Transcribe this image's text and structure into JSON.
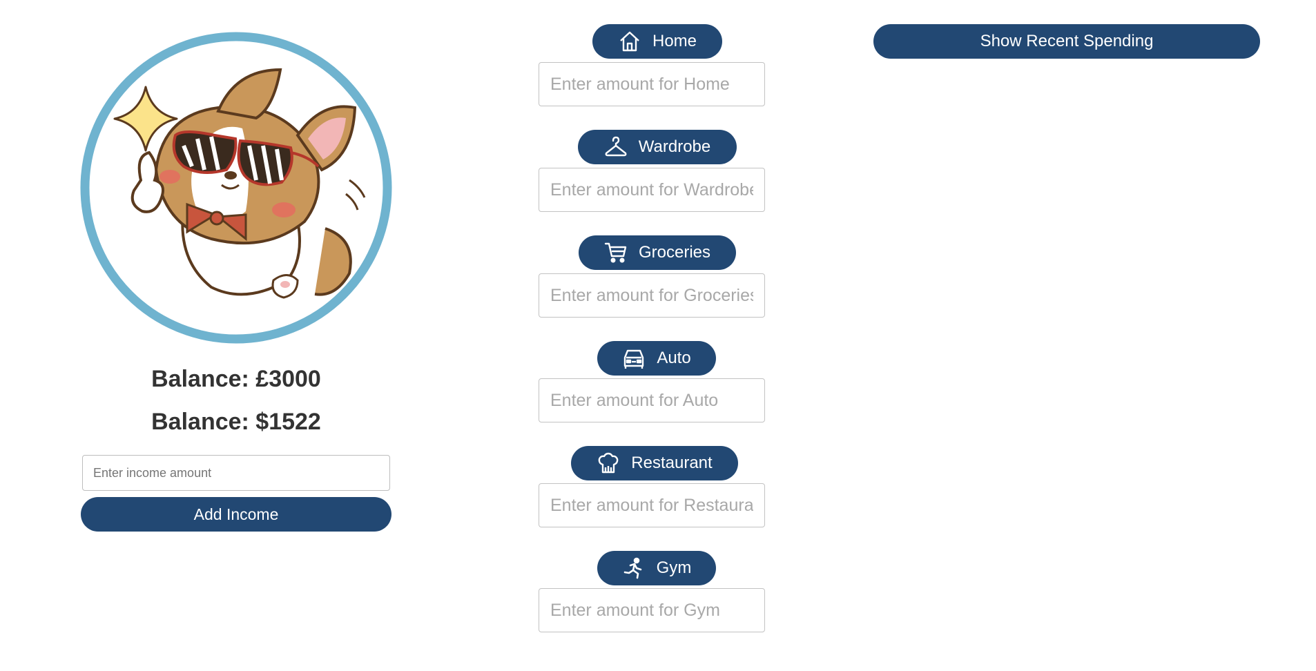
{
  "profile": {
    "avatar_icon": "corgi-with-sunglasses-avatar",
    "ring_color": "#6fb3cf"
  },
  "balances": {
    "gbp": "Balance: £3000",
    "usd": "Balance: $1522"
  },
  "income": {
    "placeholder": "Enter income amount",
    "value": "",
    "button_label": "Add Income"
  },
  "categories": [
    {
      "label": "Home",
      "icon": "home-icon",
      "placeholder": "Enter amount for Home",
      "value": ""
    },
    {
      "label": "Wardrobe",
      "icon": "hanger-icon",
      "placeholder": "Enter amount for Wardrobe",
      "value": ""
    },
    {
      "label": "Groceries",
      "icon": "cart-icon",
      "placeholder": "Enter amount for Groceries",
      "value": ""
    },
    {
      "label": "Auto",
      "icon": "car-icon",
      "placeholder": "Enter amount for Auto",
      "value": ""
    },
    {
      "label": "Restaurant",
      "icon": "chef-hat-icon",
      "placeholder": "Enter amount for Restaurant",
      "value": ""
    },
    {
      "label": "Gym",
      "icon": "runner-icon",
      "placeholder": "Enter amount for Gym",
      "value": ""
    }
  ],
  "recent": {
    "button_label": "Show Recent Spending"
  },
  "colors": {
    "primary": "#224873",
    "button_text": "#ffffff",
    "balance_text": "#333333",
    "placeholder": "#a8a8a8"
  }
}
